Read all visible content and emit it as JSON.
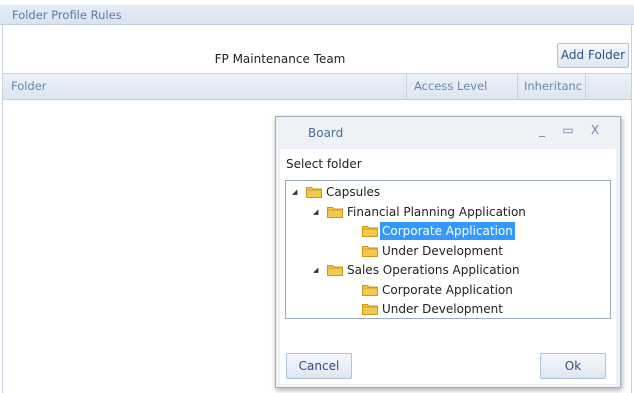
{
  "panel": {
    "title": "Folder Profile Rules"
  },
  "team_name": "FP Maintenance Team",
  "add_folder_label": "Add Folder",
  "grid": {
    "columns": [
      "Folder",
      "Access Level",
      "Inheritanc"
    ]
  },
  "dialog": {
    "title": "Board",
    "minimize_glyph": "_",
    "maximize_glyph": "▭",
    "close_glyph": "X",
    "select_label": "Select folder",
    "tree": [
      {
        "label": "Capsules",
        "level": 0,
        "expanded": true,
        "selected": false
      },
      {
        "label": "Financial Planning Application",
        "level": 1,
        "expanded": true,
        "selected": false
      },
      {
        "label": "Corporate Application",
        "level": 2,
        "expanded": false,
        "selected": true
      },
      {
        "label": "Under Development",
        "level": 2,
        "expanded": false,
        "selected": false
      },
      {
        "label": "Sales Operations Application",
        "level": 1,
        "expanded": true,
        "selected": false
      },
      {
        "label": "Corporate Application",
        "level": 2,
        "expanded": false,
        "selected": false
      },
      {
        "label": "Under Development",
        "level": 2,
        "expanded": false,
        "selected": false
      }
    ],
    "cancel_label": "Cancel",
    "ok_label": "Ok"
  },
  "colors": {
    "selection": "#3399ff",
    "folder_fill": "#f2c94c",
    "folder_stroke": "#c99a1a",
    "accent_text": "#5b7aa6"
  },
  "icons": {
    "folder": "folder-icon",
    "expand": "expanded-triangle-icon"
  }
}
